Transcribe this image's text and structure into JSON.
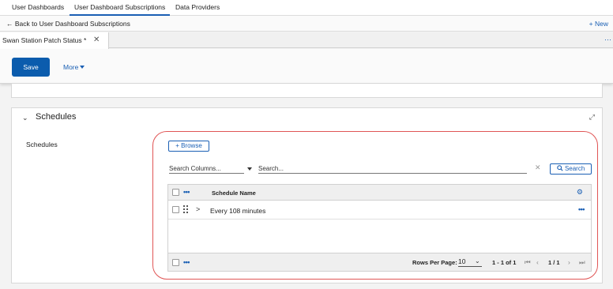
{
  "topnav": {
    "items": [
      "User Dashboards",
      "User Dashboard Subscriptions",
      "Data Providers"
    ],
    "active_index": 1
  },
  "backbar": {
    "back_label": "Back to User Dashboard Subscriptions",
    "new_label": "+ New"
  },
  "tab": {
    "label": "Swan Station Patch Status *",
    "close_glyph": "✕",
    "overflow_glyph": "⋯"
  },
  "toolbar": {
    "save_label": "Save",
    "more_label": "More"
  },
  "section": {
    "collapse_glyph": "⌄",
    "title": "Schedules",
    "field_label": "Schedules",
    "expand_glyph": "⤢"
  },
  "lookup": {
    "browse_label": "+ Browse",
    "search_columns_placeholder": "Search Columns...",
    "search_placeholder": "Search...",
    "clear_glyph": "✕",
    "search_button_label": "Search",
    "search_icon": "search-icon"
  },
  "grid": {
    "column_header": "Schedule Name",
    "rows": [
      {
        "name": "Every 108 minutes"
      }
    ],
    "row_more_glyph": "•••",
    "header_more_glyph": "•••",
    "footer_more_glyph": "•••",
    "gear_glyph": "⚙",
    "rows_per_page_label": "Rows Per Page:",
    "rows_per_page_value": "10",
    "range_label": "1 - 1 of 1",
    "page_label": "1 / 1"
  },
  "colors": {
    "accent": "#1a5fb4",
    "save_button": "#0b5cad",
    "highlight_ring": "#e05555"
  }
}
